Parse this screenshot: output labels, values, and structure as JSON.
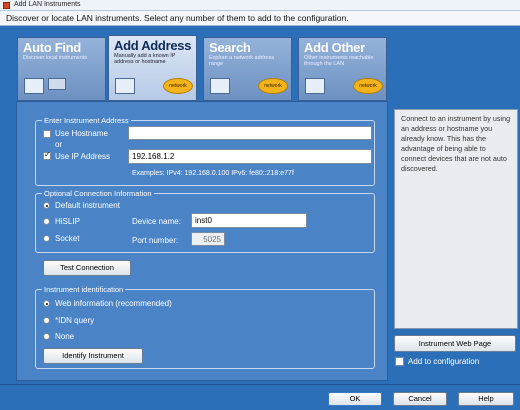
{
  "window_title": "Add LAN Instruments",
  "instruction": "Discover or locate LAN instruments. Select any number of them to add to the configuration.",
  "tabs": [
    {
      "title": "Auto Find",
      "sub": "Discover local instruments",
      "net": ""
    },
    {
      "title": "Add Address",
      "sub": "Manually add a known IP address or hostname",
      "net": "network"
    },
    {
      "title": "Search",
      "sub": "Explore a network address range",
      "net": "network"
    },
    {
      "title": "Add Other",
      "sub": "Other instruments reachable through the LAN",
      "net": "network"
    }
  ],
  "enter_address": {
    "title": "Enter Instrument Address",
    "use_hostname": "Use Hostname",
    "or": "or",
    "use_ip": "Use IP Address",
    "ip_value": "192.168.1.2",
    "hostname_value": "",
    "examples": "Examples: IPv4: 192.168.0.100   IPv6: fe80::218:e77f"
  },
  "optional": {
    "title": "Optional Connection Information",
    "default": "Default instrument",
    "hislip": "HiSLIP",
    "socket": "Socket",
    "device_label": "Device name:",
    "device_value": "inst0",
    "port_label": "Port number:",
    "port_value": "5025"
  },
  "test_connection": "Test Connection",
  "identification": {
    "title": "Instrument identification",
    "web": "Web information (recommended)",
    "idn": "*IDN query",
    "none": "None",
    "identify_button": "Identify Instrument"
  },
  "info_text": "Connect to an instrument by using an address or hostname you already know. This has the advantage of being able to connect devices that are not auto discovered.",
  "web_page_button": "Instrument Web Page",
  "add_to_config": "Add to configuration",
  "ok": "OK",
  "cancel": "Cancel",
  "help": "Help",
  "colors": {
    "panel": "#4a83c6",
    "background": "#2b6fb8"
  }
}
